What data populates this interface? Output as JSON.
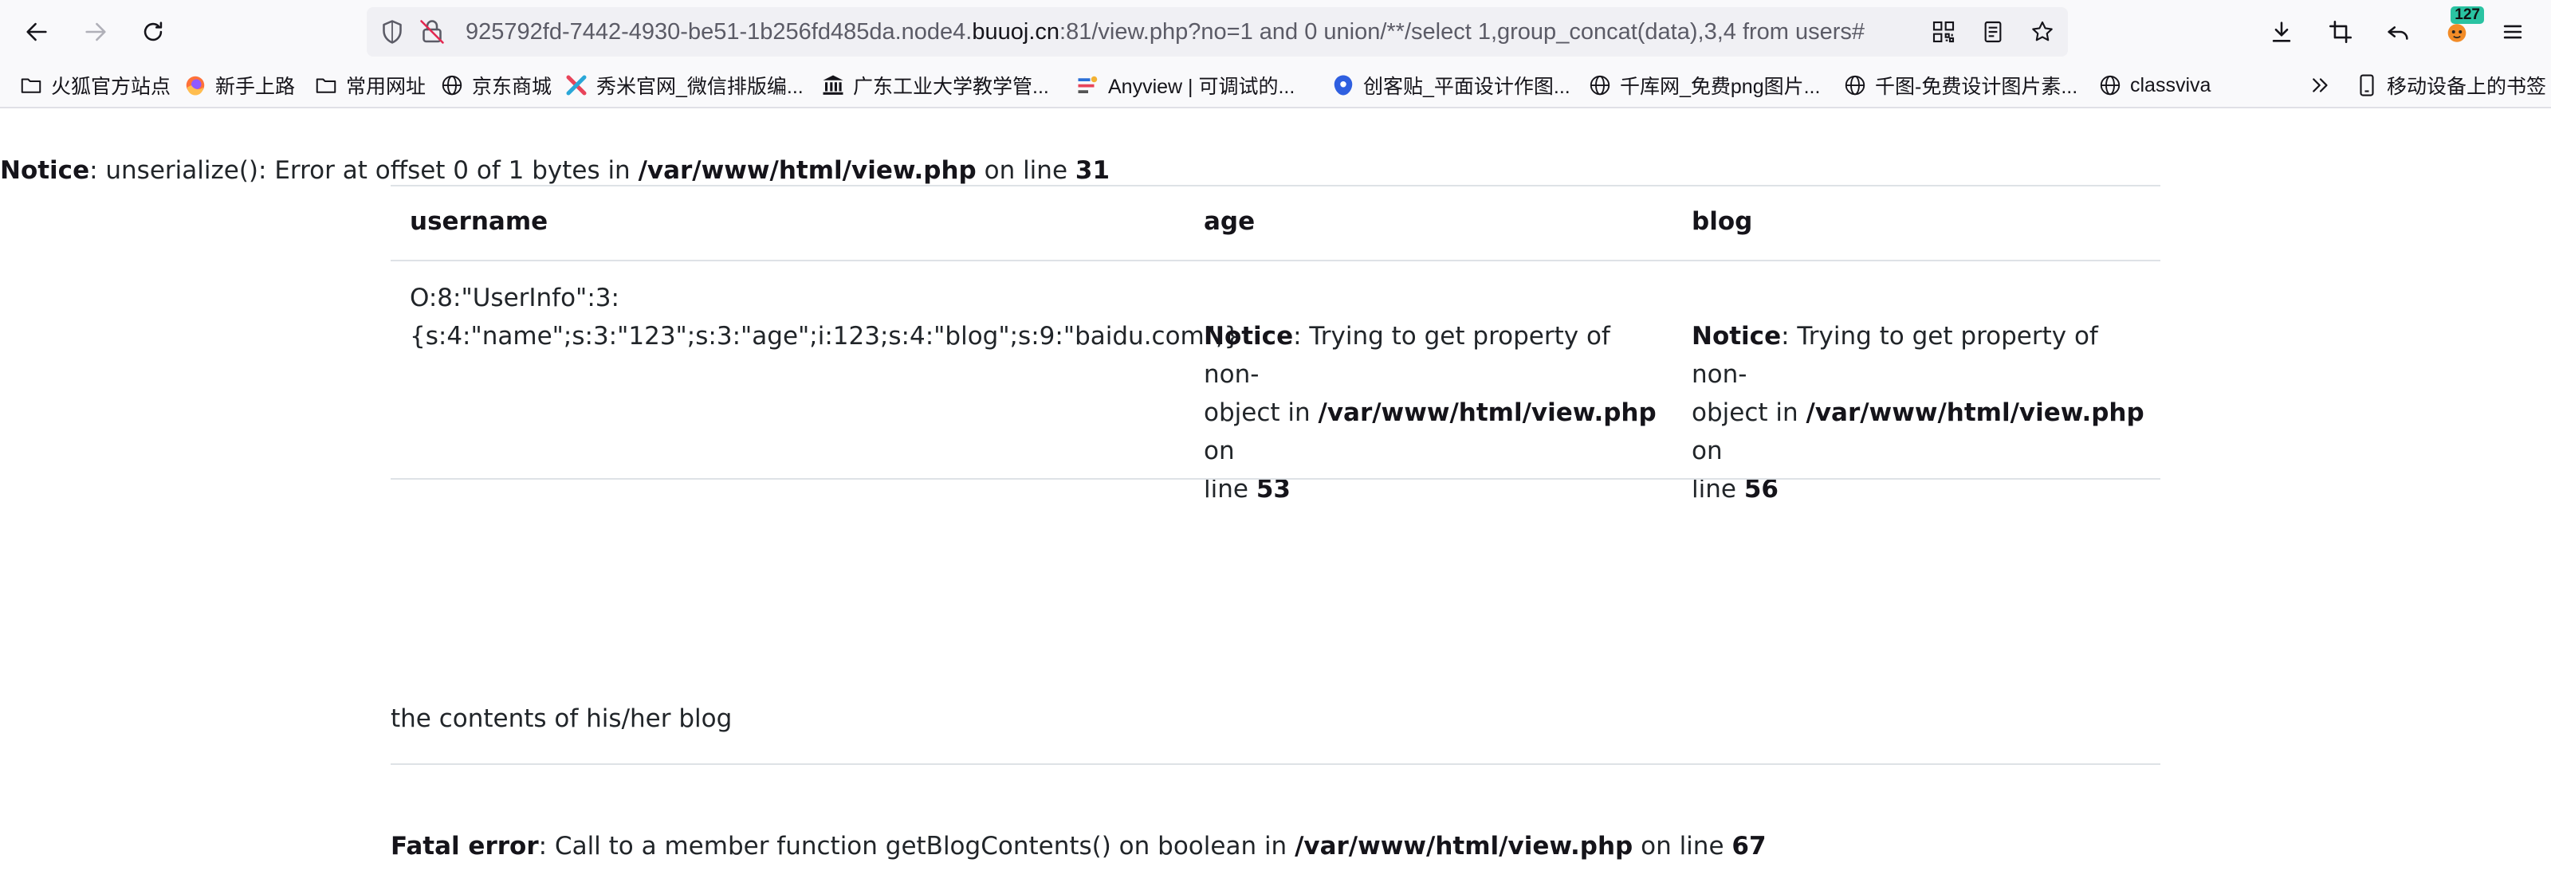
{
  "browser": {
    "url_prefix": "925792fd-7442-4930-be51-1b256fd485da.node4.",
    "url_host": "buuoj.cn",
    "url_suffix": ":81/view.php?no=1 and 0 union/**/select 1,group_concat(data),3,4 from users#",
    "extensions_badge": "127",
    "bookmarks": [
      {
        "label": "火狐官方站点",
        "icon": "folder-icon"
      },
      {
        "label": "新手上路",
        "icon": "firefox-icon"
      },
      {
        "label": "常用网址",
        "icon": "folder-icon"
      },
      {
        "label": "京东商城",
        "icon": "globe-icon"
      },
      {
        "label": "秀米官网_微信排版编...",
        "icon": "xiumi-icon"
      },
      {
        "label": "广东工业大学教学管...",
        "icon": "university-icon"
      },
      {
        "label": "Anyview | 可调试的...",
        "icon": "anyview-icon"
      },
      {
        "label": "创客贴_平面设计作图...",
        "icon": "chuangkit-icon"
      },
      {
        "label": "千库网_免费png图片...",
        "icon": "globe-icon"
      },
      {
        "label": "千图-免费设计图片素...",
        "icon": "globe-icon"
      },
      {
        "label": "classviva",
        "icon": "globe-icon"
      }
    ],
    "mobile_bookmarks": "移动设备上的书签"
  },
  "page": {
    "notice_top": {
      "label": "Notice",
      "message": ": unserialize(): Error at offset 0 of 1 bytes in ",
      "path": "/var/www/html/view.php",
      "on_line": " on line ",
      "line": "31"
    },
    "table": {
      "headers": [
        "username",
        "age",
        "blog"
      ],
      "username_value_line1": "O:8:\"UserInfo\":3:",
      "username_value_line2": "{s:4:\"name\";s:3:\"123\";s:3:\"age\";i:123;s:4:\"blog\";s:9:\"baidu.com\";}",
      "age_notice": {
        "label": "Notice",
        "message1": ": Trying to get property of non-",
        "message2": "object in ",
        "path": "/var/www/html/view.php",
        "on": " on",
        "line_word": "line ",
        "line": "53"
      },
      "blog_notice": {
        "label": "Notice",
        "message1": ": Trying to get property of non-",
        "message2": "object in ",
        "path": "/var/www/html/view.php",
        "on": " on",
        "line_word": "line ",
        "line": "56"
      }
    },
    "blog_contents_label": "the contents of his/her blog",
    "fatal_error": {
      "label": "Fatal error",
      "message": ": Call to a member function getBlogContents() on boolean in ",
      "path": "/var/www/html/view.php",
      "on_line": " on line ",
      "line": "67"
    }
  }
}
